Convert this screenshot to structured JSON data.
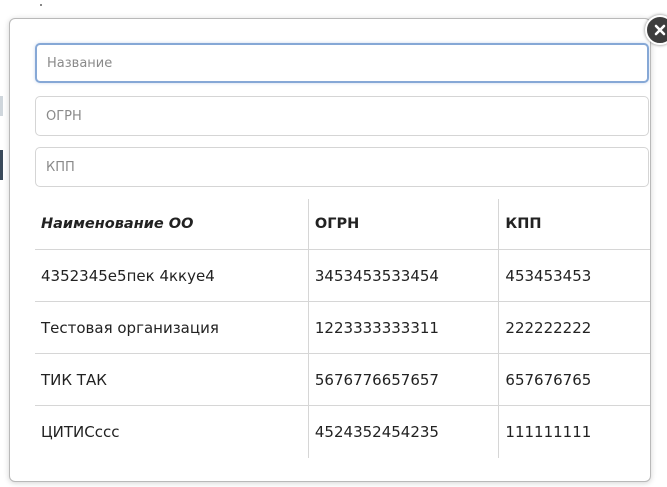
{
  "form": {
    "name_placeholder": "Название",
    "ogrn_placeholder": "ОГРН",
    "kpp_placeholder": "КПП"
  },
  "table": {
    "headers": [
      "Наименование ОО",
      "ОГРН",
      "КПП"
    ],
    "rows": [
      [
        "4352345е5пек 4ккуе4",
        "3453453533454",
        "453453453"
      ],
      [
        "Тестовая организация",
        "1223333333311",
        "222222222"
      ],
      [
        "ТИК ТАК",
        "5676776657657",
        "657676765"
      ],
      [
        "ЦИТИСссс",
        "4524352454235",
        "111111111"
      ]
    ]
  },
  "icons": {
    "close": "close-icon"
  }
}
